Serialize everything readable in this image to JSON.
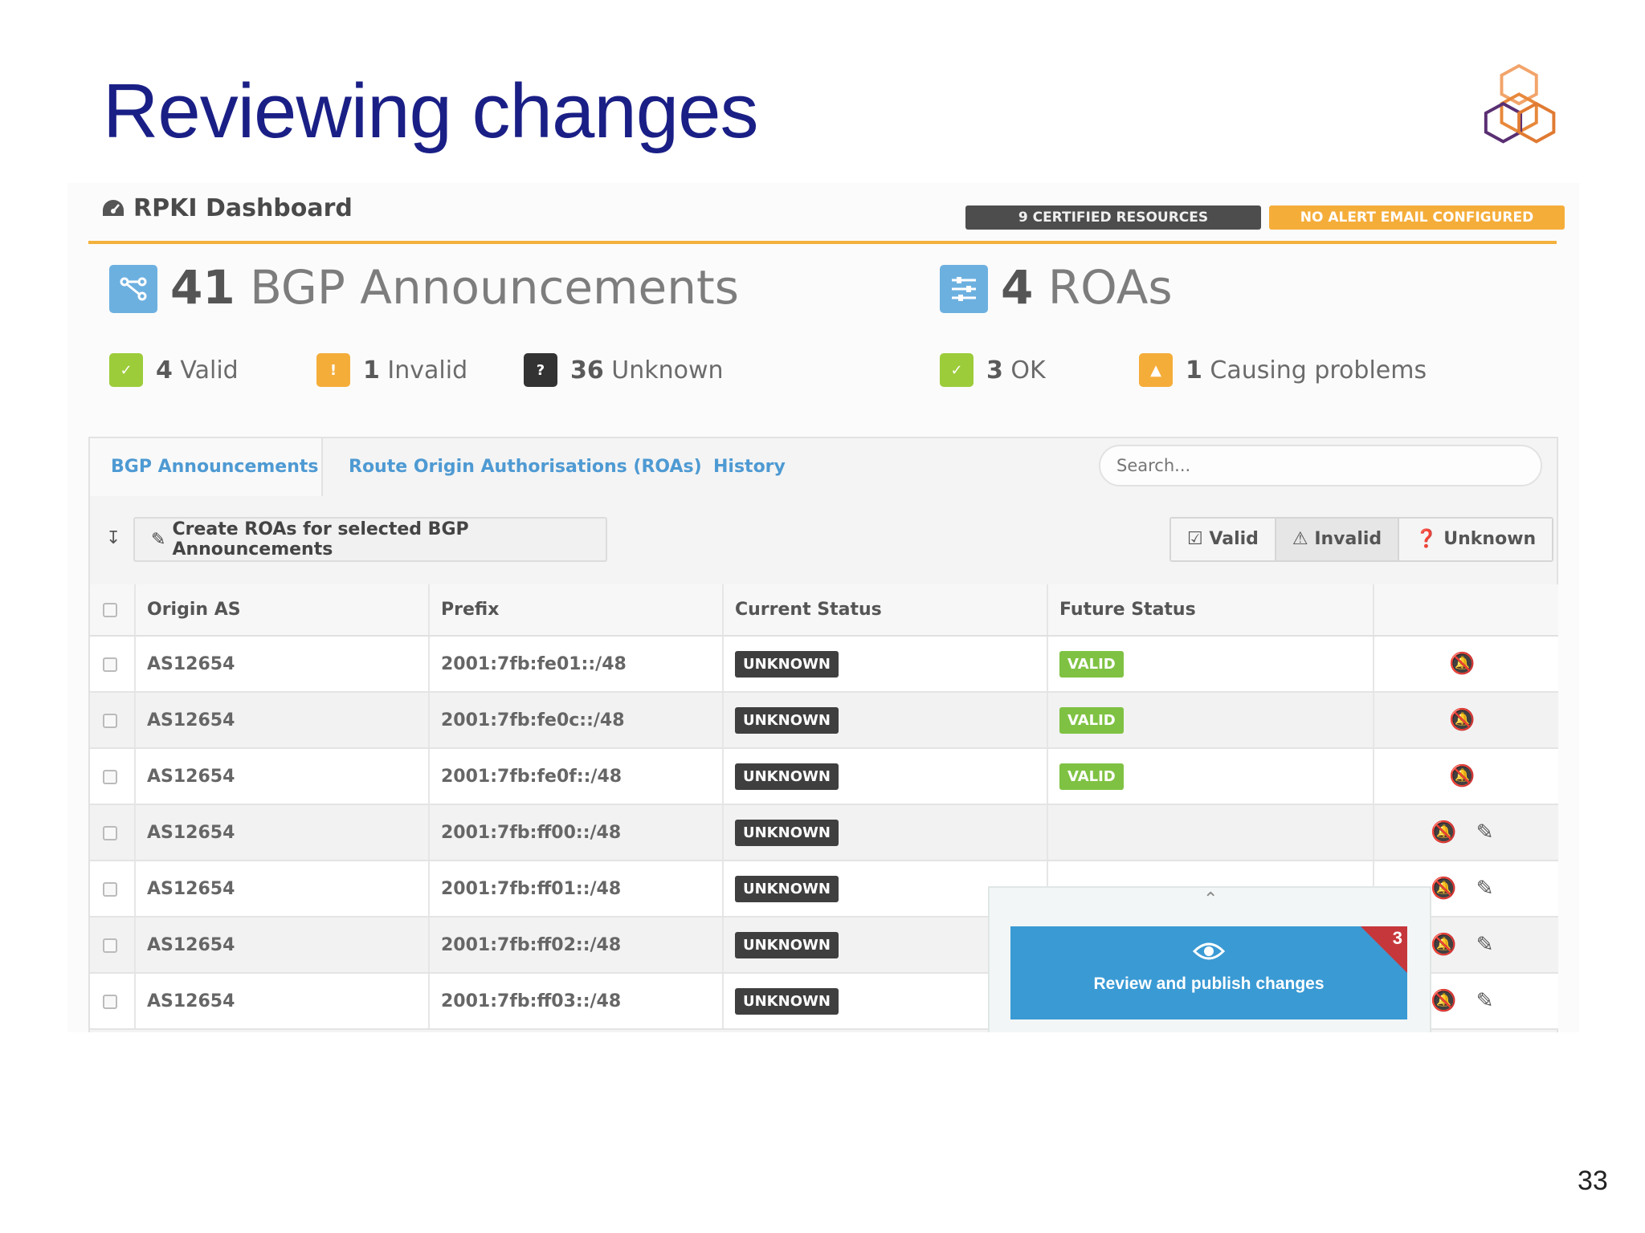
{
  "slide": {
    "title": "Reviewing changes",
    "page_number": "33"
  },
  "header": {
    "title": "RPKI Dashboard",
    "certified_badge": "9 CERTIFIED RESOURCES",
    "alert_badge": "NO ALERT EMAIL CONFIGURED"
  },
  "summary": {
    "bgp": {
      "count": "41",
      "label": "BGP Announcements"
    },
    "roas": {
      "count": "4",
      "label": "ROAs"
    },
    "bgp_stats": [
      {
        "count": "4",
        "label": "Valid",
        "color": "#9ccc3a"
      },
      {
        "count": "1",
        "label": "Invalid",
        "color": "#f5ad3a"
      },
      {
        "count": "36",
        "label": "Unknown",
        "color": "#333333"
      }
    ],
    "roa_stats": [
      {
        "count": "3",
        "label": "OK",
        "color": "#9ccc3a"
      },
      {
        "count": "1",
        "label": "Causing problems",
        "color": "#f5ad3a"
      }
    ]
  },
  "tabs": [
    {
      "label": "BGP Announcements",
      "active": true
    },
    {
      "label": "Route Origin Authorisations (ROAs)",
      "active": false
    },
    {
      "label": "History",
      "active": false
    }
  ],
  "search": {
    "placeholder": "Search..."
  },
  "toolbar": {
    "create_label": "Create ROAs for selected BGP Announcements",
    "filters": [
      {
        "label": "Valid",
        "icon": "check-square-icon"
      },
      {
        "label": "Invalid",
        "icon": "warning-icon"
      },
      {
        "label": "Unknown",
        "icon": "question-circle-icon"
      }
    ]
  },
  "table": {
    "columns": [
      "Origin AS",
      "Prefix",
      "Current Status",
      "Future Status"
    ],
    "rows": [
      {
        "origin": "AS12654",
        "prefix": "2001:7fb:fe01::/48",
        "current": "UNKNOWN",
        "future": "VALID"
      },
      {
        "origin": "AS12654",
        "prefix": "2001:7fb:fe0c::/48",
        "current": "UNKNOWN",
        "future": "VALID"
      },
      {
        "origin": "AS12654",
        "prefix": "2001:7fb:fe0f::/48",
        "current": "UNKNOWN",
        "future": "VALID"
      },
      {
        "origin": "AS12654",
        "prefix": "2001:7fb:ff00::/48",
        "current": "UNKNOWN",
        "future": ""
      },
      {
        "origin": "AS12654",
        "prefix": "2001:7fb:ff01::/48",
        "current": "UNKNOWN",
        "future": ""
      },
      {
        "origin": "AS12654",
        "prefix": "2001:7fb:ff02::/48",
        "current": "UNKNOWN",
        "future": ""
      },
      {
        "origin": "AS12654",
        "prefix": "2001:7fb:ff03::/48",
        "current": "UNKNOWN",
        "future": ""
      }
    ]
  },
  "review": {
    "label": "Review and publish changes",
    "count": "3"
  },
  "colors": {
    "accent": "#f3b13c",
    "primary": "#3a9ad4",
    "title": "#1a1f86"
  }
}
